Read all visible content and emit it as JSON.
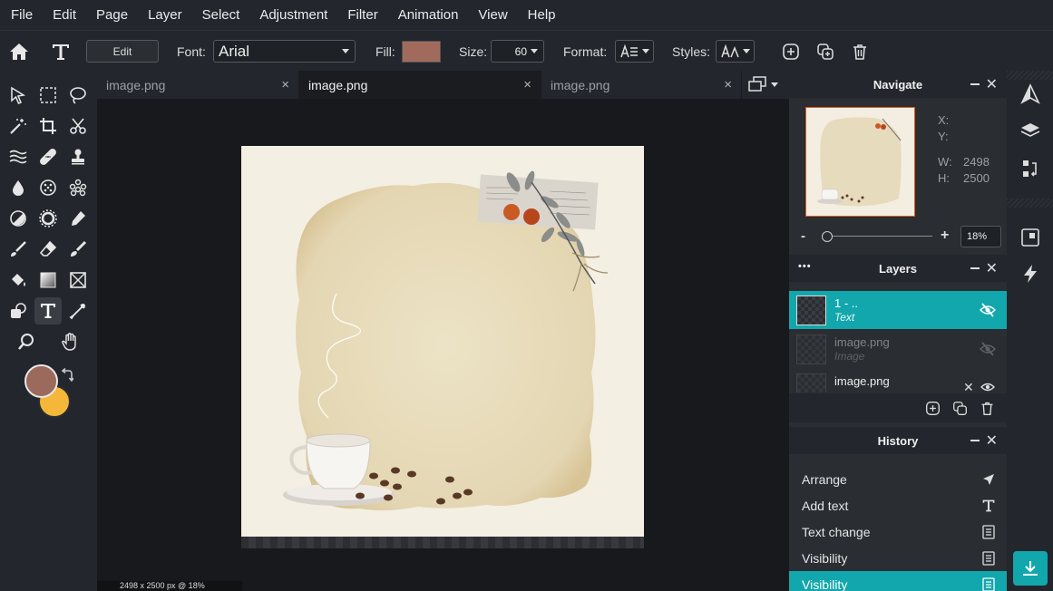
{
  "menu": [
    "File",
    "Edit",
    "Page",
    "Layer",
    "Select",
    "Adjustment",
    "Filter",
    "Animation",
    "View",
    "Help"
  ],
  "options": {
    "edit_label": "Edit",
    "font_label": "Font:",
    "font_value": "Arial",
    "fill_label": "Fill:",
    "fill_color": "#a06b5c",
    "size_label": "Size:",
    "size_value": "60",
    "format_label": "Format:",
    "styles_label": "Styles:"
  },
  "tabs": [
    {
      "label": "image.png",
      "close": "×",
      "active": false
    },
    {
      "label": "image.png",
      "close": "×",
      "active": true
    },
    {
      "label": "image.png",
      "close": "×",
      "active": false
    }
  ],
  "colors": {
    "foreground": "#9b6a5d",
    "background": "#f5b73a",
    "accent": "#12a7ac"
  },
  "status": "2498 x 2500 px @ 18%",
  "navigate": {
    "title": "Navigate",
    "x_label": "X:",
    "y_label": "Y:",
    "w_label": "W:",
    "w_value": "2498",
    "h_label": "H:",
    "h_value": "2500",
    "zoom_minus": "-",
    "zoom_plus": "+",
    "zoom_value": "18%"
  },
  "layers": {
    "title": "Layers",
    "menu_dots": "•••",
    "items": [
      {
        "name": "1 - ..",
        "type": "Text",
        "selected": true
      },
      {
        "name": "image.png",
        "type": "Image",
        "hidden": true
      },
      {
        "name": "image.png",
        "type": ""
      }
    ]
  },
  "history": {
    "title": "History",
    "items": [
      {
        "label": "Arrange",
        "icon": "pointer-icon"
      },
      {
        "label": "Add text",
        "icon": "text-icon"
      },
      {
        "label": "Text change",
        "icon": "document-icon"
      },
      {
        "label": "Visibility",
        "icon": "document-icon"
      },
      {
        "label": "Visibility",
        "icon": "document-icon",
        "active": true
      }
    ]
  }
}
